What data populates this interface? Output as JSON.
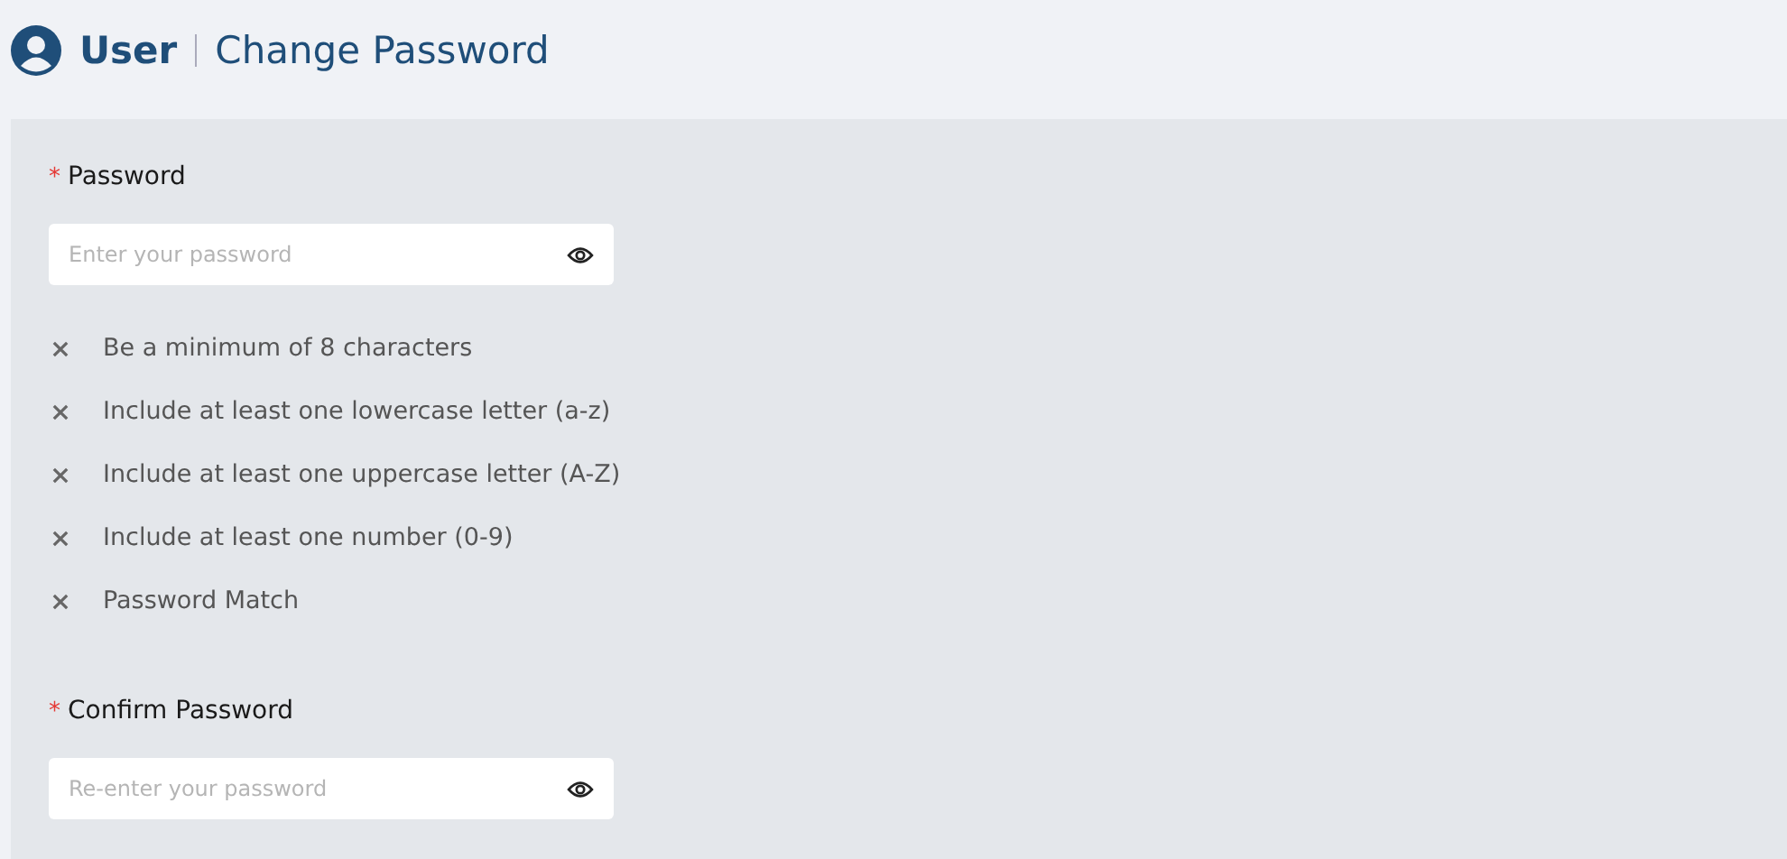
{
  "header": {
    "section": "User",
    "title": "Change Password"
  },
  "password": {
    "required_mark": "*",
    "label": "Password",
    "placeholder": "Enter your password"
  },
  "rules": [
    {
      "text": "Be a minimum of 8 characters",
      "met": false
    },
    {
      "text": "Include at least one lowercase letter (a-z)",
      "met": false
    },
    {
      "text": "Include at least one uppercase letter (A-Z)",
      "met": false
    },
    {
      "text": "Include at least one number (0-9)",
      "met": false
    },
    {
      "text": "Password Match",
      "met": false
    }
  ],
  "confirm": {
    "required_mark": "*",
    "label": "Confirm Password",
    "placeholder": "Re-enter your password"
  }
}
